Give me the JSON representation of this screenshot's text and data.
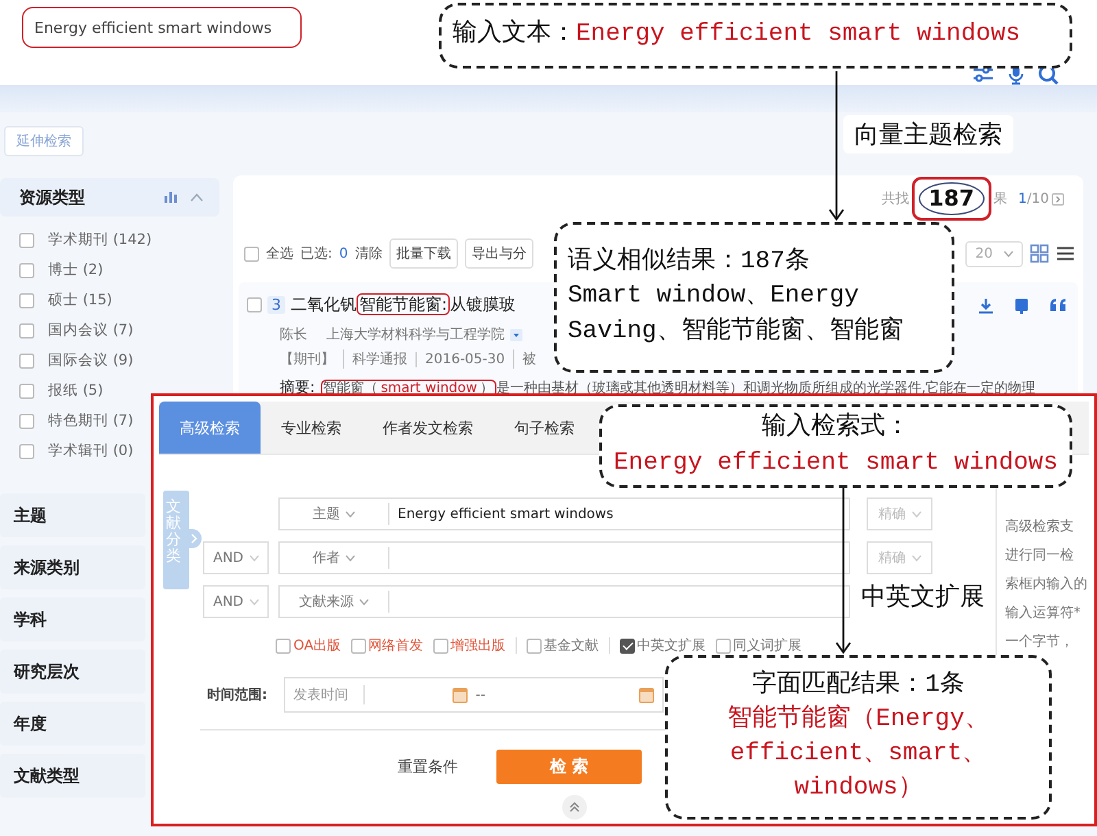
{
  "search": {
    "value": "Energy efficient smart windows",
    "highlighted": true
  },
  "sidebar": {
    "extend_button": "延伸检索",
    "facet": {
      "title": "资源类型",
      "expanded": true,
      "items": [
        {
          "label": "学术期刊 (142)",
          "checked": false
        },
        {
          "label": "博士 (2)",
          "checked": false
        },
        {
          "label": "硕士 (15)",
          "checked": false
        },
        {
          "label": "国内会议 (7)",
          "checked": false
        },
        {
          "label": "国际会议 (9)",
          "checked": false
        },
        {
          "label": "报纸 (5)",
          "checked": false
        },
        {
          "label": "特色期刊 (7)",
          "checked": false
        },
        {
          "label": "学术辑刊 (0)",
          "checked": false
        }
      ]
    },
    "sections": [
      "主题",
      "来源类别",
      "学科",
      "研究层次",
      "年度",
      "文献类型"
    ]
  },
  "results": {
    "total_prefix": "共找",
    "total": "187",
    "total_highlighted": true,
    "total_suffix": "果",
    "page_current": "1",
    "page_total": "/10",
    "select_all": {
      "label": "全选",
      "checked": false
    },
    "selected_label": "已选:",
    "selected_count": "0",
    "clear": "清除",
    "buttons": [
      "批量下载",
      "导出与分"
    ],
    "page_size": "20",
    "item": {
      "checked": false,
      "index": "3",
      "title": [
        {
          "text": "二氧化钒",
          "highlighted": false
        },
        {
          "text": "智能节能窗:",
          "highlighted": true
        },
        {
          "text": "从镀膜玻",
          "highlighted": false
        }
      ],
      "author": "陈长",
      "affiliation": "上海大学材料科学与工程学院",
      "meta": [
        "【期刊】",
        "科学通报",
        "2016-05-30",
        "被"
      ],
      "abstract_label": "摘要:",
      "abstract": [
        {
          "text": "智能窗（",
          "highlighted": true,
          "emphasis": false
        },
        {
          "text": "smart window",
          "highlighted": true,
          "emphasis": true
        },
        {
          "text": "）",
          "highlighted": true,
          "emphasis": false
        },
        {
          "text": "是一种由基材（玻璃或其他透明材料等）和调光物质所组成的光学器件,它能在一定的物理",
          "highlighted": false,
          "emphasis": false
        }
      ]
    }
  },
  "advanced": {
    "tabs": [
      {
        "label": "高级检索",
        "selected": true
      },
      {
        "label": "专业检索",
        "selected": false
      },
      {
        "label": "作者发文检索",
        "selected": false
      },
      {
        "label": "句子检索",
        "selected": false
      }
    ],
    "side_tab": "文献分类",
    "rows": [
      {
        "field": "主题",
        "value": "Energy efficient smart windows",
        "match": "精确"
      },
      {
        "operator": "AND",
        "field": "作者",
        "match": "精确"
      },
      {
        "operator": "AND",
        "field": "文献来源"
      }
    ],
    "options": [
      {
        "label": "OA出版",
        "checked": false,
        "kind": "publish"
      },
      {
        "label": "网络首发",
        "checked": false,
        "kind": "publish"
      },
      {
        "label": "增强出版",
        "checked": false,
        "kind": "publish"
      },
      {
        "label": "基金文献",
        "checked": false,
        "kind": "filter"
      },
      {
        "label": "中英文扩展",
        "checked": true,
        "kind": "expand"
      },
      {
        "label": "同义词扩展",
        "checked": false,
        "kind": "expand"
      }
    ],
    "time": {
      "label": "时间范围:",
      "placeholder": "发表时间",
      "separator": "--"
    },
    "reset": "重置条件",
    "search_button": "检 索",
    "help": [
      "高级检索支",
      "进行同一检",
      "索框内输入的",
      "输入运算符*",
      "一个字节，"
    ]
  },
  "annotations": [
    {
      "kind": "callout",
      "lines": [
        [
          {
            "text": "输入文本：",
            "emphasis": false
          },
          {
            "text": "Energy efficient smart windows",
            "emphasis": true
          }
        ]
      ]
    },
    {
      "kind": "label",
      "text": "向量主题检索"
    },
    {
      "kind": "callout",
      "lines": [
        [
          {
            "text": "语义相似结果：187条",
            "emphasis": false
          }
        ],
        [
          {
            "text": "Smart window、Energy",
            "emphasis": false
          }
        ],
        [
          {
            "text": "Saving、智能节能窗、智能窗",
            "emphasis": false
          }
        ]
      ]
    },
    {
      "kind": "callout",
      "lines": [
        [
          {
            "text": "输入检索式：",
            "emphasis": false
          }
        ],
        [
          {
            "text": "Energy efficient smart windows",
            "emphasis": true
          }
        ]
      ]
    },
    {
      "kind": "label",
      "text": "中英文扩展"
    },
    {
      "kind": "callout",
      "lines": [
        [
          {
            "text": "字面匹配结果：1条",
            "emphasis": false
          }
        ],
        [
          {
            "text": "智能节能窗（Energy、",
            "emphasis": true
          }
        ],
        [
          {
            "text": "efficient、smart、",
            "emphasis": true
          }
        ],
        [
          {
            "text": "windows）",
            "emphasis": true
          }
        ]
      ]
    }
  ]
}
